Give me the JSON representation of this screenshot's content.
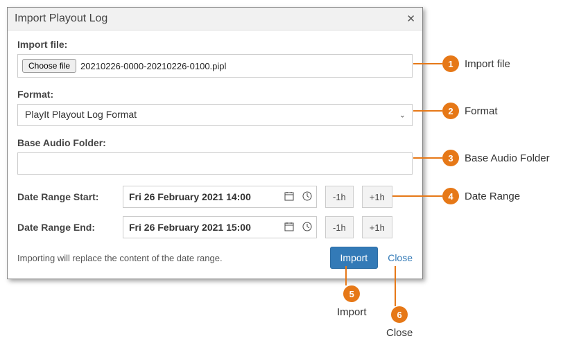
{
  "dialog": {
    "title": "Import Playout Log",
    "import_file_label": "Import file:",
    "choose_file_button": "Choose file",
    "selected_file_name": "20210226-0000-20210226-0100.pipl",
    "format_label": "Format:",
    "format_value": "PlayIt Playout Log Format",
    "base_audio_label": "Base Audio Folder:",
    "base_audio_value": "",
    "date_start_label": "Date Range Start:",
    "date_start_value": "Fri 26 February 2021 14:00",
    "date_end_label": "Date Range End:",
    "date_end_value": "Fri 26 February 2021 15:00",
    "minus_1h": "-1h",
    "plus_1h": "+1h",
    "note": "Importing will replace the content of the date range.",
    "import_button": "Import",
    "close_link": "Close"
  },
  "annotations": {
    "a1": {
      "num": "1",
      "label": "Import file"
    },
    "a2": {
      "num": "2",
      "label": "Format"
    },
    "a3": {
      "num": "3",
      "label": "Base Audio Folder"
    },
    "a4": {
      "num": "4",
      "label": "Date Range"
    },
    "a5": {
      "num": "5",
      "label": "Import"
    },
    "a6": {
      "num": "6",
      "label": "Close"
    }
  }
}
